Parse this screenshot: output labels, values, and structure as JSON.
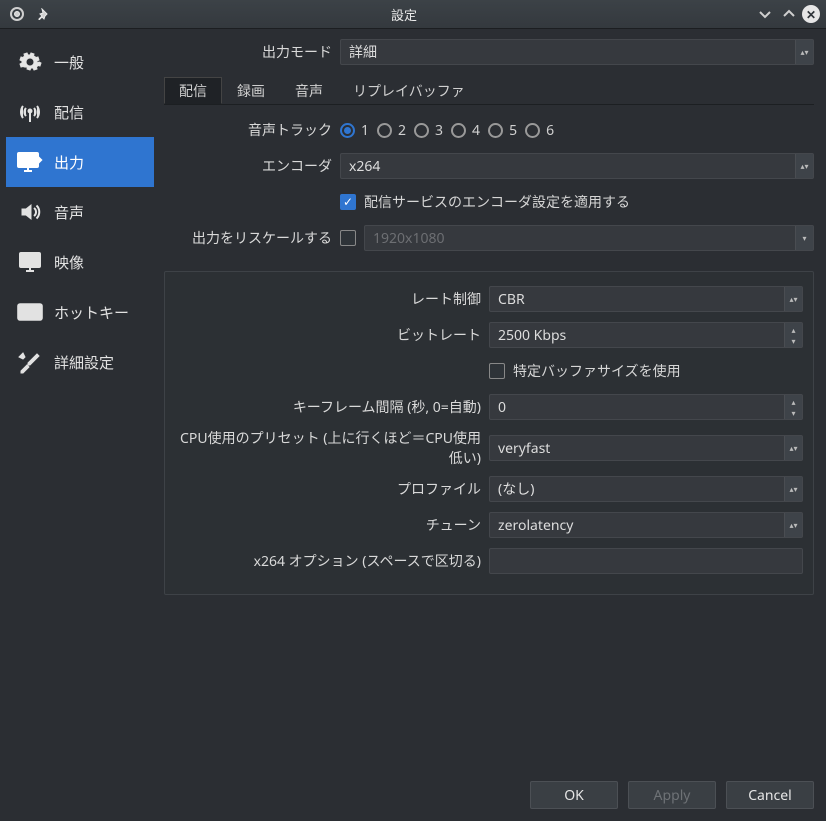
{
  "window": {
    "title": "設定"
  },
  "sidebar": {
    "items": [
      {
        "label": "一般"
      },
      {
        "label": "配信"
      },
      {
        "label": "出力",
        "active": true
      },
      {
        "label": "音声"
      },
      {
        "label": "映像"
      },
      {
        "label": "ホットキー"
      },
      {
        "label": "詳細設定"
      }
    ]
  },
  "output_mode": {
    "label": "出力モード",
    "value": "詳細"
  },
  "tabs": [
    {
      "label": "配信",
      "active": true
    },
    {
      "label": "録画"
    },
    {
      "label": "音声"
    },
    {
      "label": "リプレイバッファ"
    }
  ],
  "stream": {
    "audio_track_label": "音声トラック",
    "audio_tracks": [
      "1",
      "2",
      "3",
      "4",
      "5",
      "6"
    ],
    "audio_track_selected": 0,
    "encoder_label": "エンコーダ",
    "encoder_value": "x264",
    "enforce_label": "配信サービスのエンコーダ設定を適用する",
    "enforce_checked": true,
    "rescale_label": "出力をリスケールする",
    "rescale_checked": false,
    "rescale_value": "1920x1080"
  },
  "encoder": {
    "rate_control_label": "レート制御",
    "rate_control_value": "CBR",
    "bitrate_label": "ビットレート",
    "bitrate_value": "2500 Kbps",
    "custom_buffer_label": "特定バッファサイズを使用",
    "custom_buffer_checked": false,
    "keyint_label": "キーフレーム間隔 (秒, 0=自動)",
    "keyint_value": "0",
    "preset_label": "CPU使用のプリセット (上に行くほど＝CPU使用低い)",
    "preset_value": "veryfast",
    "profile_label": "プロファイル",
    "profile_value": "(なし)",
    "tune_label": "チューン",
    "tune_value": "zerolatency",
    "x264opts_label": "x264 オプション (スペースで区切る)",
    "x264opts_value": ""
  },
  "buttons": {
    "ok": "OK",
    "apply": "Apply",
    "cancel": "Cancel"
  }
}
